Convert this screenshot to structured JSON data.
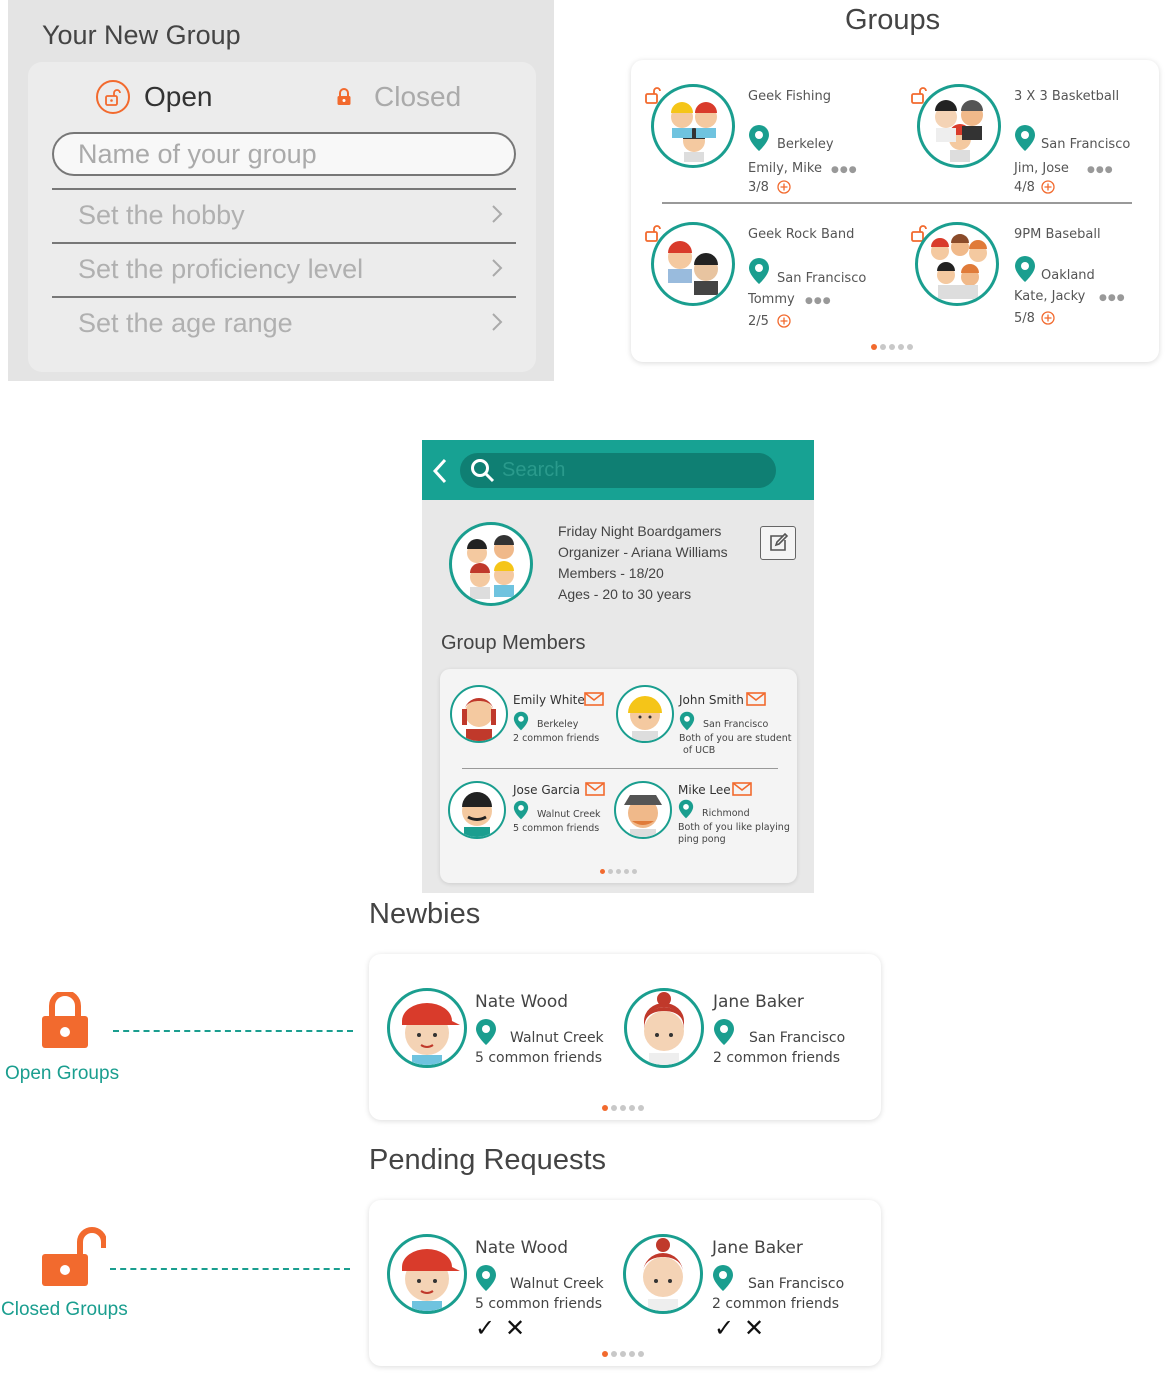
{
  "new_group": {
    "title": "Your New Group",
    "open_label": "Open",
    "closed_label": "Closed",
    "name_placeholder": "Name of your group",
    "rows": [
      "Set the hobby",
      "Set the proficiency level",
      "Set the age range"
    ]
  },
  "groups": {
    "title": "Groups",
    "items": [
      {
        "name": "Geek Fishing",
        "location": "Berkeley",
        "people": "Emily, Mike",
        "count": "3/8",
        "lock": "open"
      },
      {
        "name": "3 X 3 Basketball",
        "location": "San Francisco",
        "people": "Jim, Jose",
        "count": "4/8",
        "lock": "open"
      },
      {
        "name": "Geek Rock Band",
        "location": "San Francisco",
        "people": "Tommy",
        "count": "2/5",
        "lock": "closed"
      },
      {
        "name": "9PM Baseball",
        "location": "Oakland",
        "people": "Kate, Jacky",
        "count": "5/8",
        "lock": "closed"
      }
    ]
  },
  "group_detail": {
    "search_placeholder": "Search",
    "name": "Friday Night Boardgamers",
    "organizer": "Organizer - Ariana Williams",
    "members": "Members - 18/20",
    "ages": "Ages - 20 to 30 years",
    "members_title": "Group Members",
    "member_list": [
      {
        "name": "Emily White",
        "location": "Berkeley",
        "note": "2 common friends",
        "note2": ""
      },
      {
        "name": "John Smith",
        "location": "San Francisco",
        "note": "Both of you are student",
        "note2": "of UCB"
      },
      {
        "name": "Jose Garcia",
        "location": "Walnut Creek",
        "note": "5 common friends",
        "note2": ""
      },
      {
        "name": "Mike Lee",
        "location": "Richmond",
        "note": "Both of you like playing",
        "note2": "ping pong"
      }
    ]
  },
  "newbies": {
    "title": "Newbies",
    "people": [
      {
        "name": "Nate Wood",
        "location": "Walnut Creek",
        "friends": "5 common friends"
      },
      {
        "name": "Jane Baker",
        "location": "San Francisco",
        "friends": "2 common friends"
      }
    ]
  },
  "pending": {
    "title": "Pending Requests",
    "people": [
      {
        "name": "Nate Wood",
        "location": "Walnut Creek",
        "friends": "5 common friends",
        "accept": "✓",
        "reject": "✕"
      },
      {
        "name": "Jane Baker",
        "location": "San Francisco",
        "friends": "2 common friends",
        "accept": "✓",
        "reject": "✕"
      }
    ]
  },
  "legend": {
    "open_groups": "Open Groups",
    "closed_groups": "Closed Groups"
  },
  "colors": {
    "teal": "#1a9e8f",
    "orange": "#f26a2e",
    "header": "#17a293"
  }
}
